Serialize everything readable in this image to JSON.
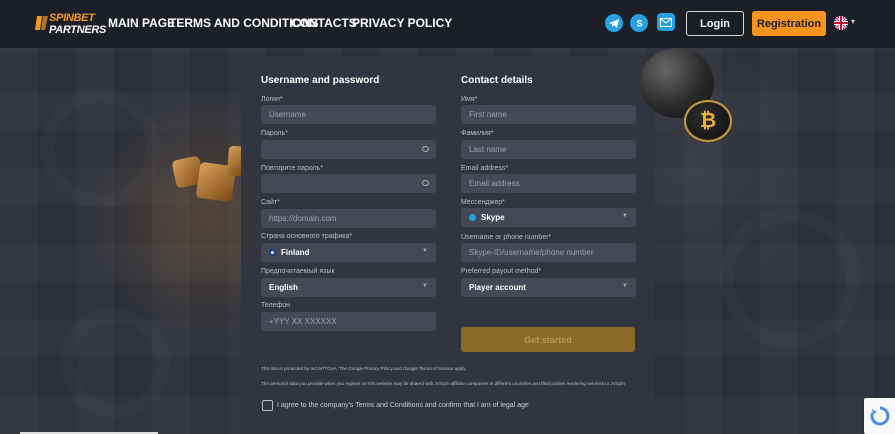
{
  "header": {
    "logo_line1": "SPINBET",
    "logo_line2": "PARTNERS",
    "nav": [
      "MAIN PAGE",
      "TERMS AND CONDITIONS",
      "CONTACTS",
      "PRIVACY POLICY"
    ],
    "login_label": "Login",
    "registration_label": "Registration",
    "social_icons": [
      "telegram-icon",
      "skype-icon",
      "mail-icon"
    ],
    "language_icon": "uk-flag-icon"
  },
  "form": {
    "left": {
      "title": "Username and password",
      "login_label": "Логин*",
      "login_placeholder": "Username",
      "password_label": "Пароль*",
      "repeat_password_label": "Повторите пароль*",
      "site_label": "Сайт*",
      "site_placeholder": "https://domain.com",
      "country_label": "Страна основного трафика*",
      "country_value": "Finland",
      "language_label": "Предпочитаемый язык",
      "language_value": "English",
      "phone_label": "Телефон",
      "phone_placeholder": "+YYY XX XXXXXX"
    },
    "right": {
      "title": "Contact details",
      "first_name_label": "Имя*",
      "first_name_placeholder": "First name",
      "last_name_label": "Фамилия*",
      "last_name_placeholder": "Last name",
      "email_label": "Email address*",
      "email_placeholder": "Email address",
      "messenger_label": "Мессенджер*",
      "messenger_value": "Skype",
      "username_label": "Username or phone number*",
      "username_placeholder": "Skype-ID/username/phone number",
      "payout_label": "Preferred payout method*",
      "payout_value": "Player account"
    },
    "submit_label": "Get started",
    "recaptcha_note": "This site is protected by reCAPTCHA. The Google Privacy Policy and Google Terms of Service apply.",
    "personal_data_note": "The personal data you provide when you register on this website may be shared with JVSpin affiliate companies in different countries and third parties rendering services to JVSpin",
    "agree_label": "I agree to the company's Terms and Conditions and confirm that I am of legal age"
  },
  "colors": {
    "accent": "#f7941d",
    "header_bg": "#1d1f27",
    "panel_bg": "#32353f",
    "field_bg": "#454955",
    "social": "#27a0e0"
  }
}
